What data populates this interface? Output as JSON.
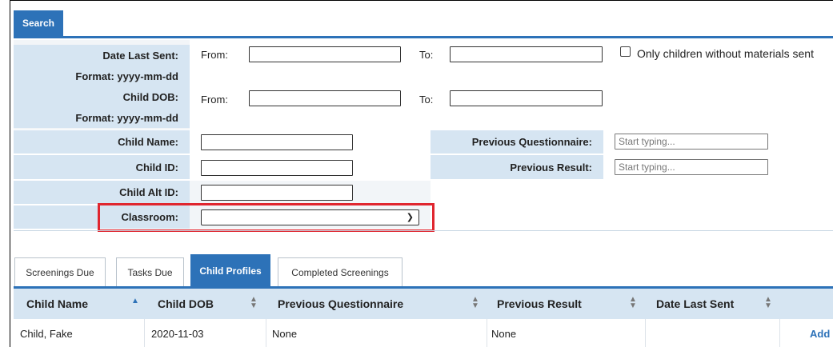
{
  "search": {
    "tab_label": "Search"
  },
  "form": {
    "date_last_sent_label": "Date Last Sent:",
    "date_format_label": "Format: yyyy-mm-dd",
    "child_dob_label": "Child DOB:",
    "from_label": "From:",
    "to_label": "To:",
    "only_children_label": "Only children without materials sent",
    "child_name_label": "Child Name:",
    "child_id_label": "Child ID:",
    "child_alt_id_label": "Child Alt ID:",
    "classroom_label": "Classroom:",
    "classroom_value": "",
    "previous_questionnaire_label": "Previous Questionnaire:",
    "previous_questionnaire_placeholder": "Start typing...",
    "previous_result_label": "Previous Result:",
    "previous_result_placeholder": "Start typing..."
  },
  "tabs": [
    {
      "label": "Screenings Due",
      "active": false
    },
    {
      "label": "Tasks Due",
      "active": false
    },
    {
      "label": "Child Profiles",
      "active": true
    },
    {
      "label": "Completed Screenings",
      "active": false
    }
  ],
  "table": {
    "columns": [
      "Child Name",
      "Child DOB",
      "Previous Questionnaire",
      "Previous Result",
      "Date Last Sent"
    ],
    "rows": [
      {
        "child_name": "Child, Fake",
        "child_dob": "2020-11-03",
        "previous_questionnaire": "None",
        "previous_result": "None",
        "date_last_sent": "",
        "action": "Add"
      }
    ]
  },
  "colors": {
    "accent": "#2d72b8",
    "label_bg": "#d6e5f2",
    "highlight": "#e0262f"
  }
}
